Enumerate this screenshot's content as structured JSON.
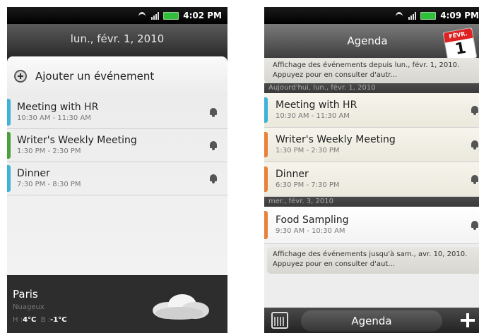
{
  "left_screen": {
    "status": {
      "time": "4:02 PM"
    },
    "date_header": "lun., févr. 1, 2010",
    "add_event_label": "Ajouter un événement",
    "events": [
      {
        "title": "Meeting with HR",
        "time": "10:30 AM - 11:30 AM",
        "color": "#3fb2d8"
      },
      {
        "title": "Writer's Weekly Meeting",
        "time": "1:30 PM - 2:30 PM",
        "color": "#4aa03a"
      },
      {
        "title": "Dinner",
        "time": "7:30 PM - 8:30 PM",
        "color": "#3fb2d8"
      }
    ],
    "weather": {
      "city": "Paris",
      "condition": "Nuageux",
      "high_label": "H :",
      "high": "4°C",
      "low_label": "B :",
      "low": "-1°C",
      "icon": "cloud-icon"
    }
  },
  "right_screen": {
    "status": {
      "time": "4:09 PM"
    },
    "header_title": "Agenda",
    "calendar_icon": {
      "month": "FÉVR.",
      "day": "1"
    },
    "info_top": "Affichage des événements depuis lun., févr. 1, 2010. Appuyez pour en consulter d'autr...",
    "day_separators": [
      "Aujourd'hui, lun., févr. 1, 2010",
      "mer., févr. 3, 2010"
    ],
    "events_today": [
      {
        "title": "Meeting with HR",
        "time": "10:30 AM - 11:30 AM",
        "color": "#3fb2d8"
      },
      {
        "title": "Writer's Weekly Meeting",
        "time": "1:30 PM - 2:30 PM",
        "color": "#e8823a"
      },
      {
        "title": "Dinner",
        "time": "6:30 PM - 7:30 PM",
        "color": "#e8823a"
      }
    ],
    "events_later": [
      {
        "title": "Food Sampling",
        "time": "9:30 AM - 10:30 AM",
        "color": "#e8823a"
      }
    ],
    "info_bottom": "Affichage des événements jusqu'à sam., avr. 10, 2010. Appuyez pour en consulter d'aut...",
    "bottom_bar": {
      "label": "Agenda"
    }
  },
  "colors": {
    "accent_blue": "#3fb2d8",
    "accent_green": "#4aa03a",
    "accent_orange": "#e8823a",
    "calendar_red": "#d22222"
  }
}
